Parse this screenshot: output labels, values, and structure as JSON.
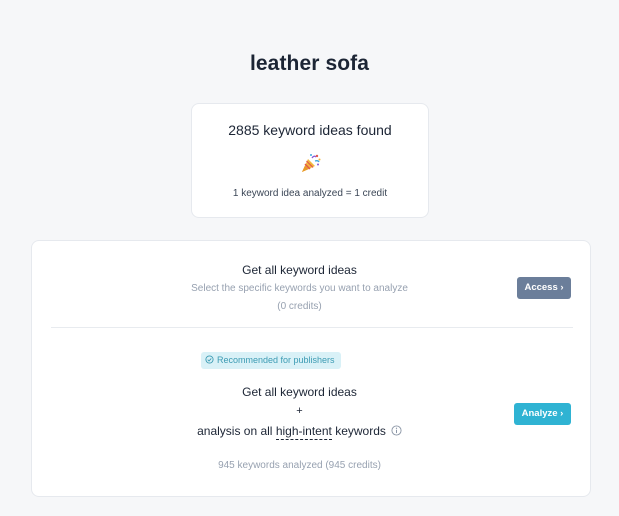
{
  "page": {
    "title": "leather sofa"
  },
  "summary": {
    "found_text": "2885 keyword ideas found",
    "icon": "party-popper-icon",
    "credit_note": "1 keyword idea analyzed = 1 credit"
  },
  "option_basic": {
    "title": "Get all keyword ideas",
    "subtitle": "Select the specific keywords you want to analyze",
    "credits": "(0 credits)",
    "button_label": "Access ›"
  },
  "option_full": {
    "badge_label": "Recommended for publishers",
    "title": "Get all keyword ideas",
    "plus": "+",
    "line_prefix": "analysis on all ",
    "line_highlight": "high-intent",
    "line_suffix": " keywords",
    "credits": "945 keywords analyzed (945 credits)",
    "button_label": "Analyze ›"
  },
  "colors": {
    "background": "#f6f7f9",
    "access_button": "#6b7e9a",
    "analyze_button": "#2fb3d3",
    "badge_background": "#d9f1f7",
    "badge_text": "#3c9bb3",
    "muted_text": "#97a1b0"
  }
}
